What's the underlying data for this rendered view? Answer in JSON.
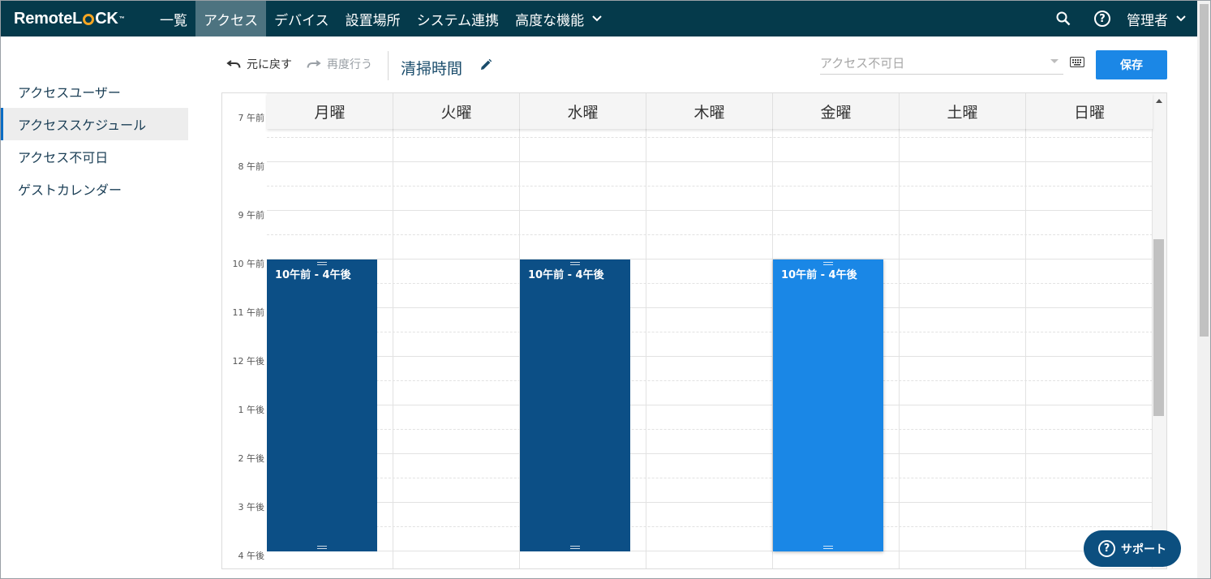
{
  "brand": {
    "logo_prefix": "Remote",
    "logo_suffix_l": "L",
    "logo_suffix_ck": "CK",
    "logo_tm": "™"
  },
  "nav": {
    "items": [
      {
        "label": "一覧"
      },
      {
        "label": "アクセス"
      },
      {
        "label": "デバイス"
      },
      {
        "label": "設置場所"
      },
      {
        "label": "システム連携"
      },
      {
        "label": "高度な機能"
      }
    ],
    "active_index": 1,
    "admin_label": "管理者"
  },
  "sidebar": {
    "items": [
      {
        "label": "アクセスユーザー"
      },
      {
        "label": "アクセススケジュール"
      },
      {
        "label": "アクセス不可日"
      },
      {
        "label": "ゲストカレンダー"
      }
    ],
    "active_index": 1
  },
  "toolbar": {
    "undo_label": "元に戻す",
    "redo_label": "再度行う",
    "schedule_name": "清掃時間",
    "select_placeholder": "アクセス不可日",
    "save_label": "保存"
  },
  "calendar": {
    "days": [
      "月曜",
      "火曜",
      "水曜",
      "木曜",
      "金曜",
      "土曜",
      "日曜"
    ],
    "time_labels": [
      "7 午前",
      "8 午前",
      "9 午前",
      "10 午前",
      "11 午前",
      "12 午後",
      "1 午後",
      "2 午後",
      "3 午後",
      "4 午後"
    ],
    "events": [
      {
        "day": "月曜",
        "label": "10午前 - 4午後",
        "style": "dark"
      },
      {
        "day": "水曜",
        "label": "10午前 - 4午後",
        "style": "dark"
      },
      {
        "day": "金曜",
        "label": "10午前 - 4午後",
        "style": "light"
      }
    ]
  },
  "support_label": "サポート",
  "colors": {
    "nav_bg": "#053a4b",
    "nav_active": "#4d7380",
    "accent": "#1b87e6",
    "event_dark": "#0c4f86",
    "event_selected": "#1a87e6",
    "support_bg": "#0c4f7f"
  }
}
